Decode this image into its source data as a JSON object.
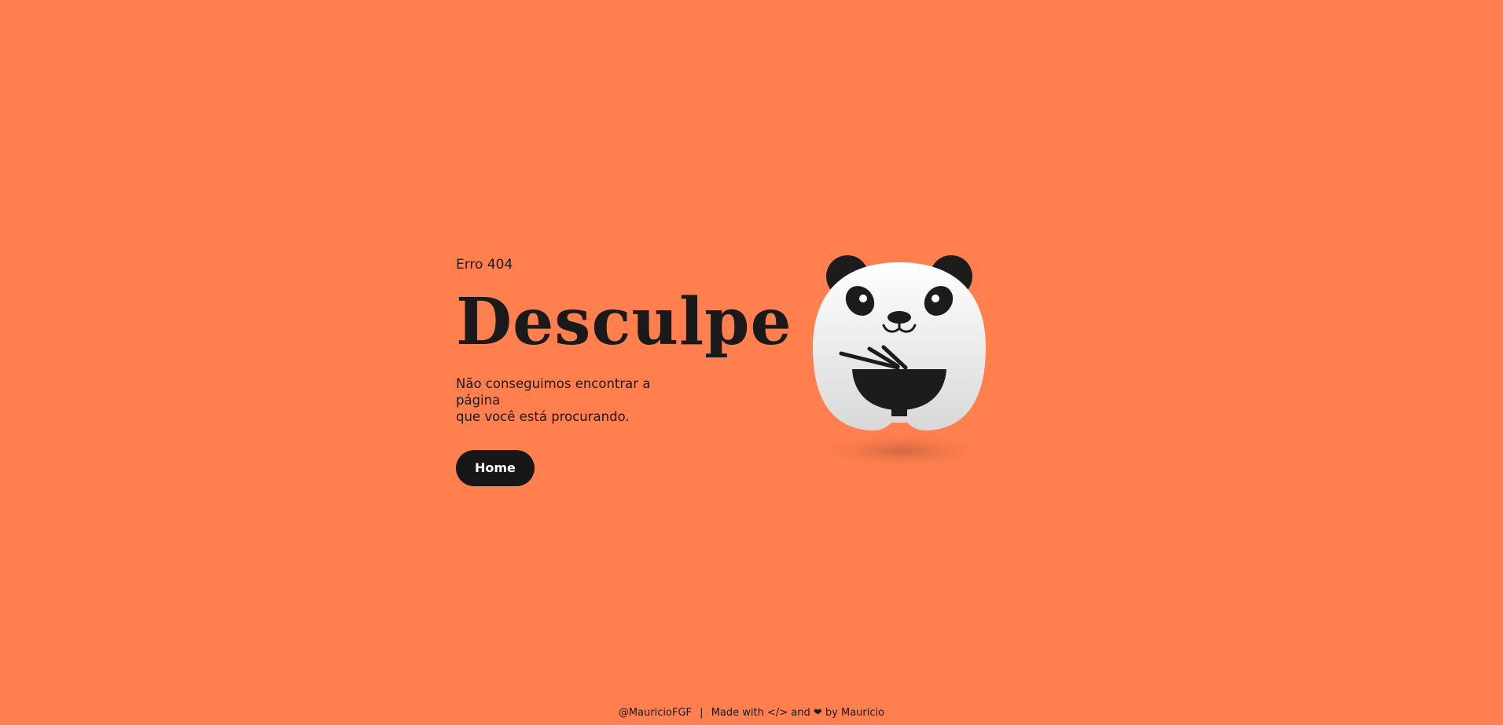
{
  "error": {
    "code_label": "Erro 404",
    "title": "Desculpe",
    "message_line1": "Não conseguimos encontrar a página",
    "message_line2": "que você está procurando."
  },
  "actions": {
    "home_label": "Home"
  },
  "footer": {
    "handle": "@MauricioFGF",
    "separator": "|",
    "made_with": "Made with </> and",
    "heart": "❤",
    "by": "by Mauricio"
  },
  "colors": {
    "background": "#ff7f4f",
    "button": "#171717",
    "text": "#1a1a1a"
  },
  "illustration": {
    "icon": "panda-eating-noodles-icon"
  }
}
